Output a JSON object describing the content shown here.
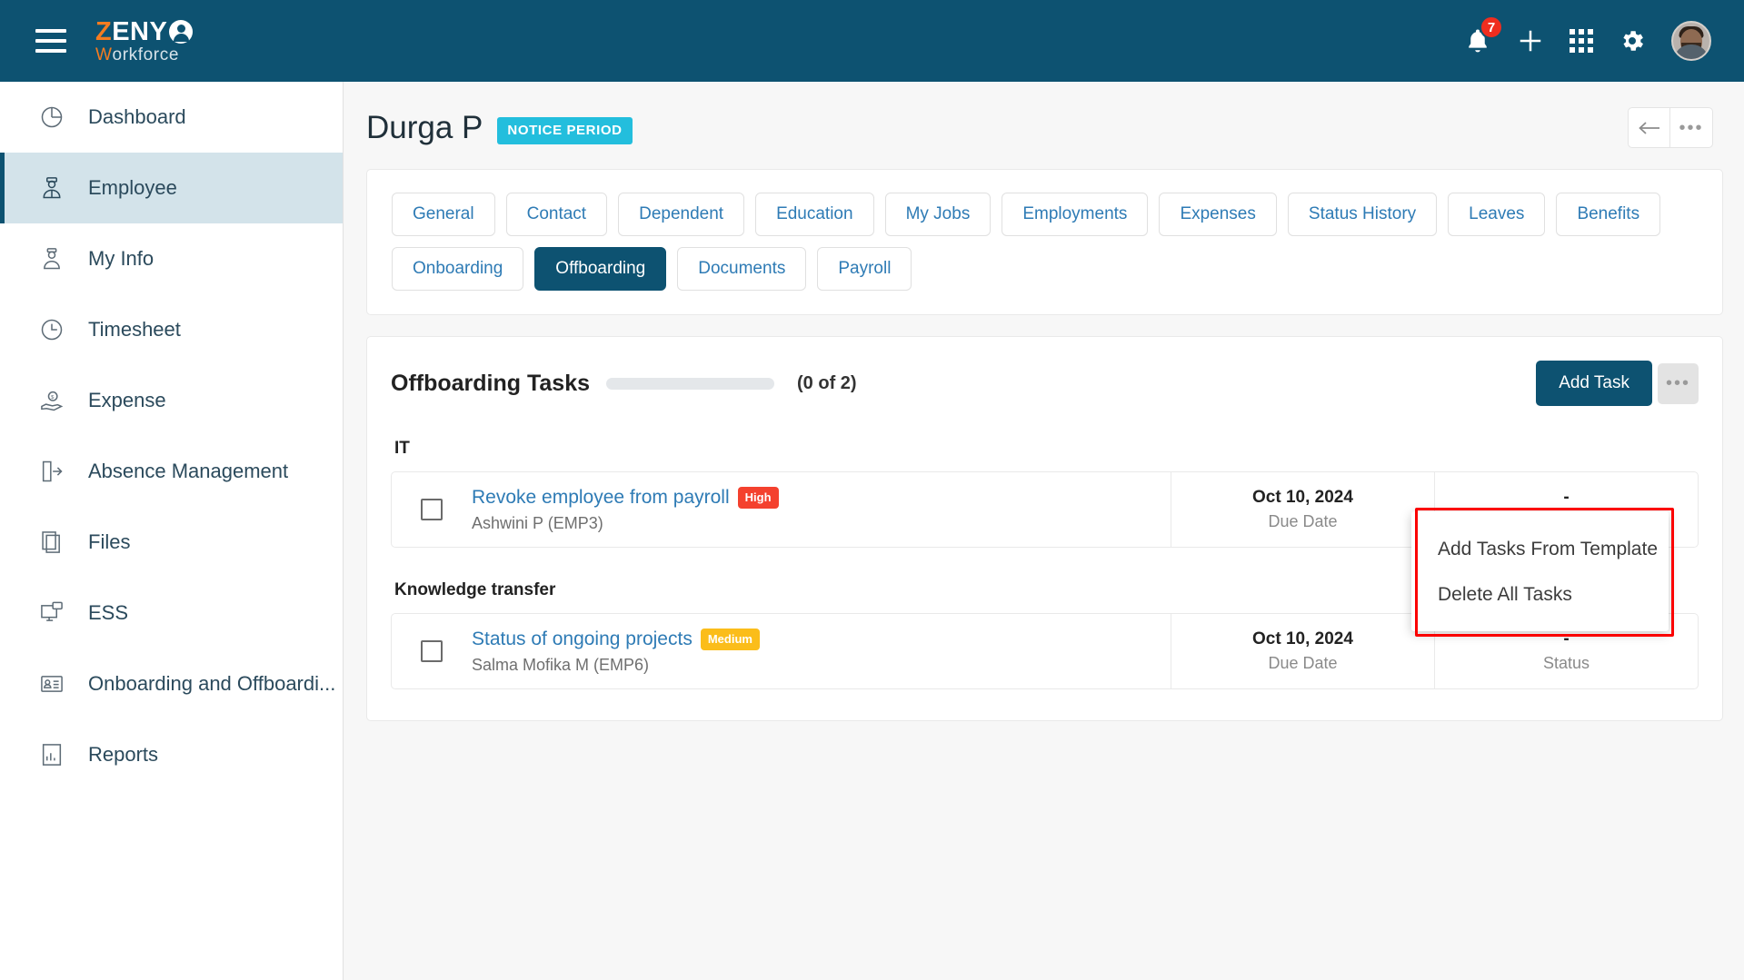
{
  "topbar": {
    "menu_icon": "hamburger-icon",
    "logo": {
      "part1": "Z",
      "part2": "ENY",
      "part3": "W",
      "part4": "orkforce"
    },
    "notifications": {
      "icon": "bell-icon",
      "count": "7"
    },
    "add_icon": "plus-icon",
    "apps_icon": "grid-apps-icon",
    "settings_icon": "gear-icon",
    "avatar": "user-avatar"
  },
  "sidebar": {
    "items": [
      {
        "label": "Dashboard",
        "icon": "pie-chart-icon",
        "active": false
      },
      {
        "label": "Employee",
        "icon": "employee-icon",
        "active": true
      },
      {
        "label": "My Info",
        "icon": "person-info-icon",
        "active": false
      },
      {
        "label": "Timesheet",
        "icon": "clock-icon",
        "active": false
      },
      {
        "label": "Expense",
        "icon": "hand-money-icon",
        "active": false
      },
      {
        "label": "Absence Management",
        "icon": "exit-door-icon",
        "active": false
      },
      {
        "label": "Files",
        "icon": "files-icon",
        "active": false
      },
      {
        "label": "ESS",
        "icon": "monitor-chat-icon",
        "active": false
      },
      {
        "label": "Onboarding and Offboardi...",
        "icon": "id-card-icon",
        "active": false
      },
      {
        "label": "Reports",
        "icon": "report-icon",
        "active": false
      }
    ]
  },
  "page": {
    "title": "Durga P",
    "status_chip": "NOTICE PERIOD",
    "back_icon": "arrow-left-icon",
    "more_icon": "ellipsis-icon"
  },
  "tabs": [
    {
      "label": "General",
      "active": false
    },
    {
      "label": "Contact",
      "active": false
    },
    {
      "label": "Dependent",
      "active": false
    },
    {
      "label": "Education",
      "active": false
    },
    {
      "label": "My Jobs",
      "active": false
    },
    {
      "label": "Employments",
      "active": false
    },
    {
      "label": "Expenses",
      "active": false
    },
    {
      "label": "Status History",
      "active": false
    },
    {
      "label": "Leaves",
      "active": false
    },
    {
      "label": "Benefits",
      "active": false
    },
    {
      "label": "Onboarding",
      "active": false
    },
    {
      "label": "Offboarding",
      "active": true
    },
    {
      "label": "Documents",
      "active": false
    },
    {
      "label": "Payroll",
      "active": false
    }
  ],
  "tasks_section": {
    "title": "Offboarding Tasks",
    "progress_percent": 0,
    "count_label": "(0 of 2)",
    "add_task_label": "Add Task",
    "more_icon": "ellipsis-icon",
    "columns": {
      "due_date": "Due Date",
      "status": "Status"
    },
    "groups": [
      {
        "name": "IT",
        "tasks": [
          {
            "title": "Revoke employee from payroll",
            "priority": "High",
            "priority_color": "#f4412e",
            "assignee": "Ashwini P (EMP3)",
            "due_date": "Oct 10, 2024",
            "status": "-",
            "checked": false
          }
        ]
      },
      {
        "name": "Knowledge transfer",
        "tasks": [
          {
            "title": "Status of ongoing projects",
            "priority": "Medium",
            "priority_color": "#fbbd1a",
            "assignee": "Salma Mofika M (EMP6)",
            "due_date": "Oct 10, 2024",
            "status": "-",
            "checked": false
          }
        ]
      }
    ]
  },
  "dropdown_menu": {
    "highlight_color": "#fb0000",
    "items": [
      {
        "label": "Add Tasks From Template"
      },
      {
        "label": "Delete All Tasks"
      }
    ]
  },
  "theme": {
    "brand_dark": "#0d5271",
    "brand_orange": "#f57c20",
    "link_blue": "#2e7bb5",
    "chip_cyan": "#23bedd"
  }
}
